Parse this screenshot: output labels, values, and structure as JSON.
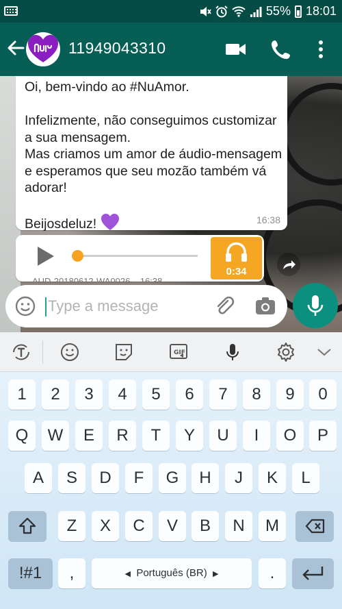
{
  "status_bar": {
    "battery": "55%",
    "time": "18:01"
  },
  "app_bar": {
    "contact_name": "11949043310"
  },
  "messages": [
    {
      "text": "Oi, bem-vindo ao #NuAmor.\n\nInfelizmente, não conseguimos customizar a sua mensagem.\nMas criamos um amor de áudio-mensagem e esperamos que seu mozão também vá adorar!\n\nBeijosdeluz! ",
      "emoji": "purple-heart",
      "time": "16:38"
    }
  ],
  "audio_message": {
    "duration": "0:34",
    "file_label": "AUD-20180612-WA0026",
    "time": "16:38",
    "progress": 0
  },
  "composer": {
    "placeholder": "Type a message"
  },
  "keyboard": {
    "number_row": [
      "1",
      "2",
      "3",
      "4",
      "5",
      "6",
      "7",
      "8",
      "9",
      "0"
    ],
    "row1": [
      "Q",
      "W",
      "E",
      "R",
      "T",
      "Y",
      "U",
      "I",
      "O",
      "P"
    ],
    "row2": [
      "A",
      "S",
      "D",
      "F",
      "G",
      "H",
      "J",
      "K",
      "L"
    ],
    "row3": [
      "Z",
      "X",
      "C",
      "V",
      "B",
      "N",
      "M"
    ],
    "symbols_key": "!#1",
    "comma_key": ",",
    "space_label": "Português (BR)",
    "period_key": "."
  },
  "colors": {
    "whatsapp_dark": "#075e54",
    "status_bar": "#054d44",
    "mic_button": "#0b8f7e",
    "audio_accent": "#f5a623",
    "avatar_purple": "#8a1ec0"
  }
}
